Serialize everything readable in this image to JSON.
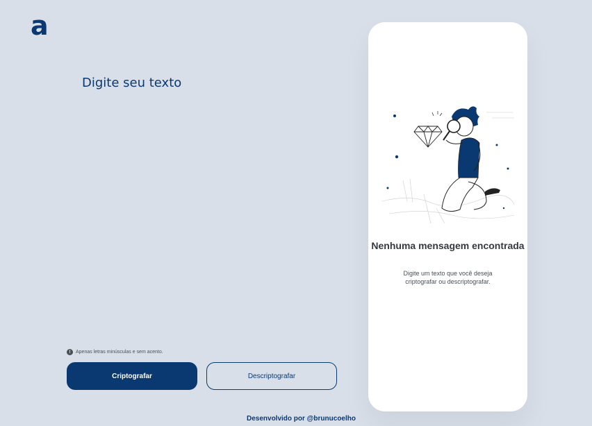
{
  "logo": {
    "text": "a"
  },
  "input": {
    "placeholder": "Digite seu texto",
    "value": ""
  },
  "hint": {
    "icon": "!",
    "text": "Apenas letras minúsculas e sem acento."
  },
  "buttons": {
    "encrypt_label": "Criptografar",
    "decrypt_label": "Descriptografar"
  },
  "footer": {
    "text": "Desenvolvido por @brunucoelho"
  },
  "output_panel": {
    "title": "Nenhuma mensagem encontrada",
    "subtitle": "Digite um texto que você deseja criptografar ou descriptografar.",
    "illustration": "person-with-magnifying-glass-diamond"
  },
  "colors": {
    "background": "#d8dfe9",
    "accent": "#0a3871",
    "panel": "#ffffff",
    "text_dark": "#343a40"
  }
}
